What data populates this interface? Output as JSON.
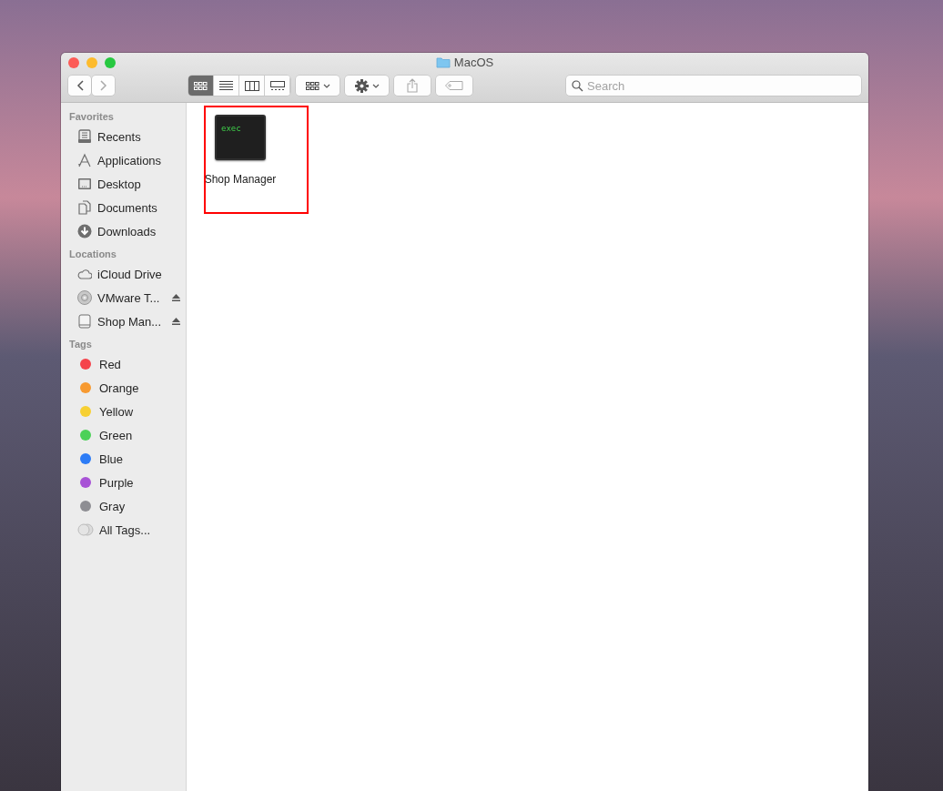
{
  "window": {
    "title": "MacOS"
  },
  "toolbar": {
    "view_modes": [
      {
        "kind": "icon",
        "selected": true
      },
      {
        "kind": "list",
        "selected": false
      },
      {
        "kind": "column",
        "selected": false
      },
      {
        "kind": "gallery",
        "selected": false
      }
    ],
    "search": {
      "placeholder": "Search"
    }
  },
  "sidebar": {
    "sections": [
      {
        "heading": "Favorites",
        "items": [
          {
            "kind": "recents",
            "label": "Recents"
          },
          {
            "kind": "applications",
            "label": "Applications"
          },
          {
            "kind": "desktop",
            "label": "Desktop"
          },
          {
            "kind": "documents",
            "label": "Documents"
          },
          {
            "kind": "downloads",
            "label": "Downloads"
          }
        ]
      },
      {
        "heading": "Locations",
        "items": [
          {
            "kind": "cloud",
            "label": "iCloud Drive",
            "ejectable": false
          },
          {
            "kind": "disc",
            "label": "VMware T...",
            "ejectable": true
          },
          {
            "kind": "drive",
            "label": "Shop Man...",
            "ejectable": true
          }
        ]
      },
      {
        "heading": "Tags",
        "items": [
          {
            "kind": "tag",
            "label": "Red",
            "color": "#f5434b"
          },
          {
            "kind": "tag",
            "label": "Orange",
            "color": "#f79a31"
          },
          {
            "kind": "tag",
            "label": "Yellow",
            "color": "#f7d033"
          },
          {
            "kind": "tag",
            "label": "Green",
            "color": "#4cd158"
          },
          {
            "kind": "tag",
            "label": "Blue",
            "color": "#2d7cf6"
          },
          {
            "kind": "tag",
            "label": "Purple",
            "color": "#a852d6"
          },
          {
            "kind": "tag",
            "label": "Gray",
            "color": "#8e8e93"
          },
          {
            "kind": "all_tags",
            "label": "All Tags..."
          }
        ]
      }
    ]
  },
  "files": [
    {
      "name": "Shop Manager",
      "icon_text": "exec",
      "highlighted": true
    }
  ]
}
